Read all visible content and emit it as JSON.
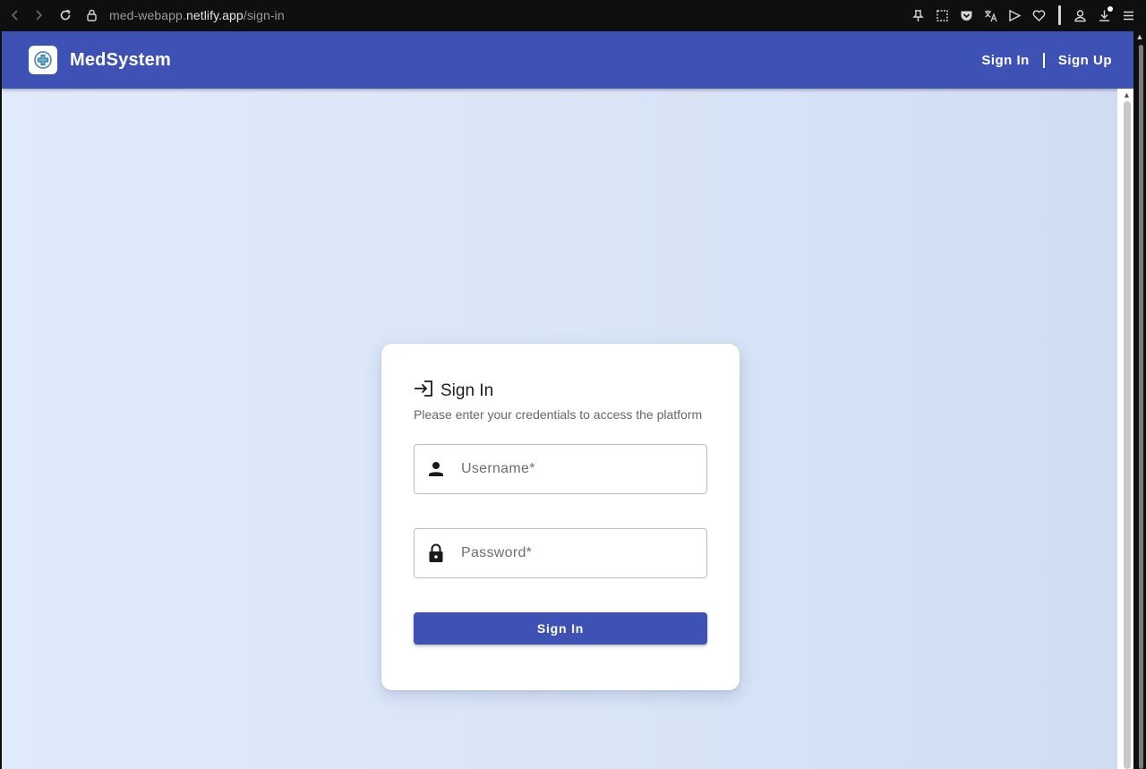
{
  "browser": {
    "url_prefix": "med-webapp.",
    "url_host": "netlify.app",
    "url_path": "/sign-in",
    "icons": [
      "back-icon",
      "forward-icon",
      "reload-icon",
      "lock-icon",
      "pin-icon",
      "screenshot-icon",
      "pocket-icon",
      "translate-icon",
      "send-icon",
      "heart-icon",
      "account-icon",
      "download-icon",
      "menu-icon"
    ]
  },
  "appbar": {
    "brand": "MedSystem",
    "logo_icon": "medical-cross-icon",
    "color": "#3e51b5",
    "links": {
      "sign_in": "Sign In",
      "sign_up": "Sign Up"
    }
  },
  "card": {
    "title_icon": "login-icon",
    "title": "Sign In",
    "subtitle": "Please enter your credentials to access the platform",
    "username": {
      "placeholder": "Username*",
      "value": "",
      "icon": "person-icon"
    },
    "password": {
      "placeholder": "Password*",
      "value": "",
      "icon": "lock-icon"
    },
    "submit_label": "Sign In"
  }
}
